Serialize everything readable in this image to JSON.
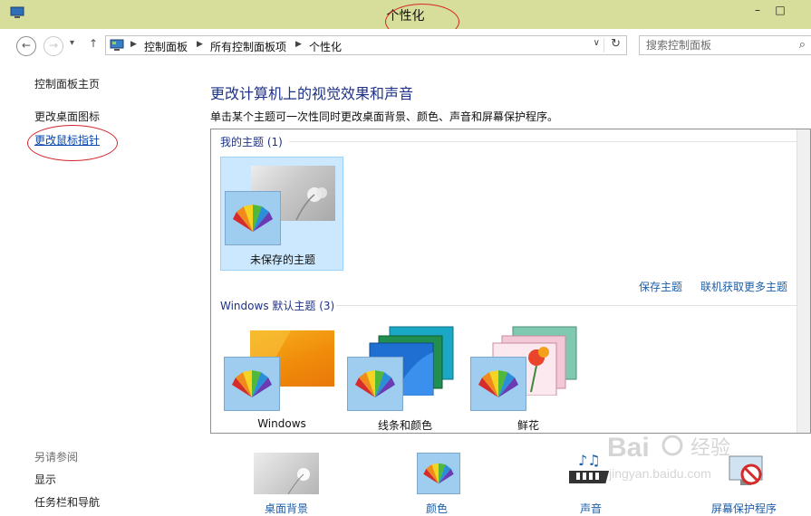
{
  "window": {
    "title": "个性化",
    "controls": {
      "minimize": "–",
      "maximize": "□"
    }
  },
  "nav": {
    "back_glyph": "←",
    "forward_glyph": "→",
    "recent_glyph": "▾",
    "up_glyph": "↑"
  },
  "address": {
    "crumbs": [
      "控制面板",
      "所有控制面板项",
      "个性化"
    ],
    "separator": "▶",
    "dropdown_glyph": "∨",
    "refresh_glyph": "↻"
  },
  "search": {
    "placeholder": "搜索控制面板",
    "glyph": "⌕"
  },
  "sidebar": {
    "home": "控制面板主页",
    "links": [
      "更改桌面图标",
      "更改鼠标指针"
    ],
    "see_also_title": "另请参阅",
    "see_also": [
      "显示",
      "任务栏和导航"
    ]
  },
  "main": {
    "heading": "更改计算机上的视觉效果和声音",
    "description": "单击某个主题可一次性同时更改桌面背景、颜色、声音和屏幕保护程序。",
    "my_themes": {
      "header": "我的主题 (1)",
      "items": [
        {
          "name": "未保存的主题",
          "selected": true
        }
      ]
    },
    "actions": {
      "save": "保存主题",
      "get_more": "联机获取更多主题"
    },
    "default_themes": {
      "header": "Windows 默认主题 (3)",
      "items": [
        {
          "name": "Windows"
        },
        {
          "name": "线条和颜色"
        },
        {
          "name": "鲜花"
        }
      ]
    }
  },
  "bottom_bar": {
    "items": [
      "桌面背景",
      "颜色",
      "声音",
      "屏幕保护程序"
    ]
  },
  "watermark": {
    "brand": "Bai",
    "brand2": "经验",
    "url": "jingyan.baidu.com"
  },
  "colors": {
    "titlebar": "#d7dd9a",
    "link": "#1e5ea8",
    "heading": "#1e3287",
    "selected_tile": "#cce8ff",
    "annotation": "#d4262b"
  }
}
